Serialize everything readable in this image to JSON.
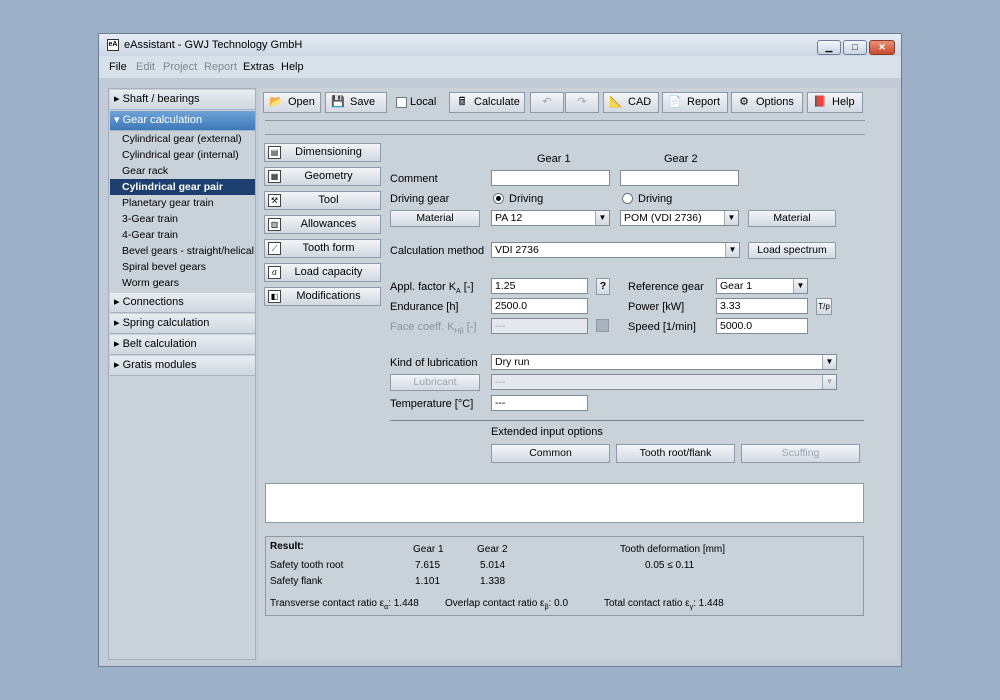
{
  "window": {
    "app_icon": "eA",
    "title": "eAssistant - GWJ Technology GmbH",
    "minimize_icon": "minimize-icon",
    "maximize_icon": "maximize-icon",
    "close_icon": "close-icon"
  },
  "menu": [
    {
      "label": "File",
      "enabled": true
    },
    {
      "label": "Edit",
      "enabled": false
    },
    {
      "label": "Project",
      "enabled": false
    },
    {
      "label": "Report",
      "enabled": false
    },
    {
      "label": "Extras",
      "enabled": true
    },
    {
      "label": "Help",
      "enabled": true
    }
  ],
  "sidebar": {
    "sections": [
      {
        "label": "Shaft / bearings"
      },
      {
        "label": "Gear calculation"
      },
      {
        "label": "Connections"
      },
      {
        "label": "Spring calculation"
      },
      {
        "label": "Belt calculation"
      },
      {
        "label": "Gratis modules"
      }
    ],
    "gear_items": [
      "Cylindrical gear (external)",
      "Cylindrical gear (internal)",
      "Gear rack",
      "Cylindrical gear pair",
      "Planetary gear train",
      "3-Gear train",
      "4-Gear train",
      "Bevel gears - straight/helical",
      "Spiral bevel gears",
      "Worm gears"
    ],
    "selected_item": "Cylindrical gear pair"
  },
  "toolbar": {
    "open": "Open",
    "save": "Save",
    "local": "Local",
    "calculate": "Calculate",
    "undo_icon": "undo-icon",
    "redo_icon": "redo-icon",
    "cad": "CAD",
    "report": "Report",
    "options": "Options",
    "help": "Help"
  },
  "sidetabs": [
    "Dimensioning",
    "Geometry",
    "Tool",
    "Allowances",
    "Tooth form",
    "Load capacity",
    "Modifications"
  ],
  "form": {
    "gear1_header": "Gear 1",
    "gear2_header": "Gear 2",
    "comment_label": "Comment",
    "comment1": "",
    "comment2": "",
    "driving_gear_label": "Driving gear",
    "driving1": "Driving",
    "driving2": "Driving",
    "material_button": "Material",
    "material1": "PA 12",
    "material2": "POM (VDI 2736)",
    "calc_method_label": "Calculation method",
    "calc_method": "VDI 2736",
    "load_spectrum_button": "Load spectrum",
    "appl_factor_label": "Appl. factor K",
    "appl_factor_sub": "A",
    "appl_factor_unit": " [-]",
    "appl_factor": "1.25",
    "help_q": "?",
    "endurance_label": "Endurance [h]",
    "endurance": "2500.0",
    "face_coeff_label": "Face coeff. K",
    "face_coeff_sub": "Hβ",
    "face_coeff_unit": " [-]",
    "face_coeff": "---",
    "reference_gear_label": "Reference gear",
    "reference_gear": "Gear 1",
    "power_label": "Power [kW]",
    "power": "3.33",
    "tp_button": "T/p",
    "speed_label": "Speed [1/min]",
    "speed": "5000.0",
    "lubrication_label": "Kind of lubrication",
    "lubrication": "Dry run",
    "lubricant_button": "Lubricant",
    "lubricant": "---",
    "temperature_label": "Temperature [°C]",
    "temperature": "---",
    "extended_label": "Extended input options",
    "common_button": "Common",
    "tooth_root_button": "Tooth root/flank",
    "scuffing_button": "Scuffing"
  },
  "result": {
    "title": "Result:",
    "gear1": "Gear 1",
    "gear2": "Gear 2",
    "deformation_header": "Tooth deformation [mm]",
    "safety_root_label": "Safety tooth root",
    "safety_root_1": "7.615",
    "safety_root_2": "5.014",
    "safety_flank_label": "Safety flank",
    "safety_flank_1": "1.101",
    "safety_flank_2": "1.338",
    "deformation": "0.05 ≤  0.11",
    "transverse_label": "Transverse contact ratio ε",
    "transverse_sub": "α",
    "transverse_value": ": 1.448",
    "overlap_label": "Overlap contact ratio ε",
    "overlap_sub": "β",
    "overlap_value": ": 0.0",
    "total_label": "Total contact ratio ε",
    "total_sub": "γ",
    "total_value": ": 1.448"
  }
}
